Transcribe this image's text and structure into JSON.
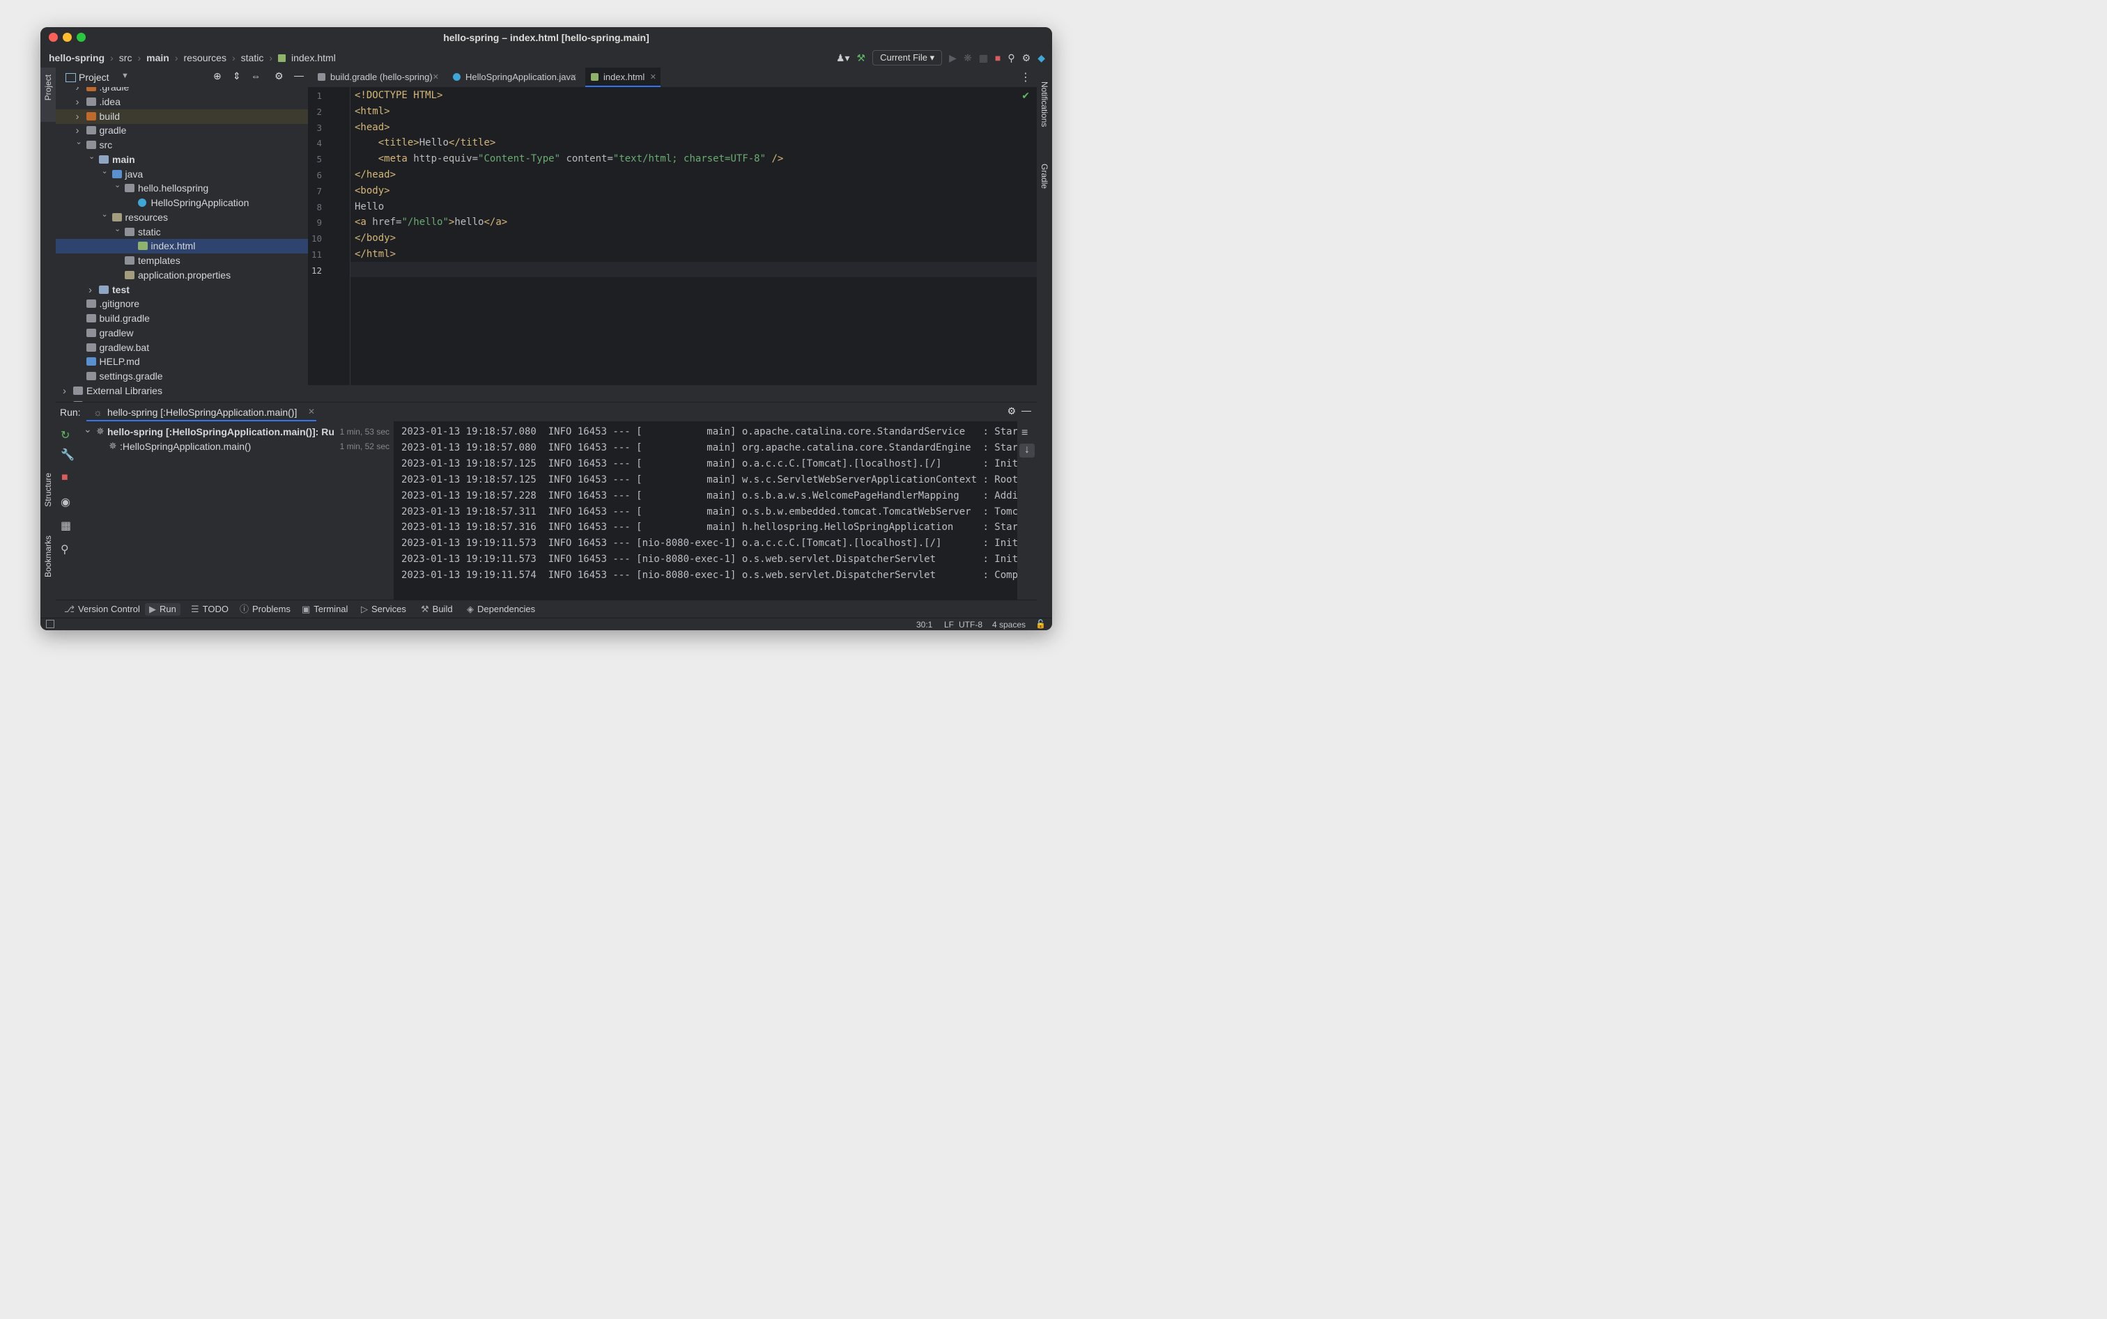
{
  "window": {
    "title": "hello-spring – index.html [hello-spring.main]"
  },
  "breadcrumb": [
    "hello-spring",
    "src",
    "main",
    "resources",
    "static",
    "index.html"
  ],
  "toolbar": {
    "run_config": "Current File"
  },
  "project_panel": {
    "title": "Project"
  },
  "tree": [
    {
      "label": ".gradle",
      "depth": 1,
      "arrow": ">",
      "kind": "folder-orange"
    },
    {
      "label": ".idea",
      "depth": 1,
      "arrow": ">",
      "kind": "folder"
    },
    {
      "label": "build",
      "depth": 1,
      "arrow": ">",
      "kind": "folder-orange"
    },
    {
      "label": "gradle",
      "depth": 1,
      "arrow": ">",
      "kind": "folder"
    },
    {
      "label": "src",
      "depth": 1,
      "arrow": "v",
      "kind": "folder"
    },
    {
      "label": "main",
      "depth": 2,
      "arrow": "v",
      "kind": "folder-module",
      "bold": true
    },
    {
      "label": "java",
      "depth": 3,
      "arrow": "v",
      "kind": "folder-blue"
    },
    {
      "label": "hello.hellospring",
      "depth": 4,
      "arrow": "v",
      "kind": "package"
    },
    {
      "label": "HelloSpringApplication",
      "depth": 5,
      "arrow": "",
      "kind": "class"
    },
    {
      "label": "resources",
      "depth": 3,
      "arrow": "v",
      "kind": "folder-res"
    },
    {
      "label": "static",
      "depth": 4,
      "arrow": "v",
      "kind": "folder"
    },
    {
      "label": "index.html",
      "depth": 5,
      "arrow": "",
      "kind": "html",
      "selected": true
    },
    {
      "label": "templates",
      "depth": 4,
      "arrow": "",
      "kind": "folder"
    },
    {
      "label": "application.properties",
      "depth": 4,
      "arrow": "",
      "kind": "props"
    },
    {
      "label": "test",
      "depth": 2,
      "arrow": ">",
      "kind": "folder-module",
      "bold": true
    },
    {
      "label": ".gitignore",
      "depth": 1,
      "arrow": "",
      "kind": "file"
    },
    {
      "label": "build.gradle",
      "depth": 1,
      "arrow": "",
      "kind": "gradle"
    },
    {
      "label": "gradlew",
      "depth": 1,
      "arrow": "",
      "kind": "exec"
    },
    {
      "label": "gradlew.bat",
      "depth": 1,
      "arrow": "",
      "kind": "file"
    },
    {
      "label": "HELP.md",
      "depth": 1,
      "arrow": "",
      "kind": "md"
    },
    {
      "label": "settings.gradle",
      "depth": 1,
      "arrow": "",
      "kind": "gradle"
    },
    {
      "label": "External Libraries",
      "depth": 0,
      "arrow": ">",
      "kind": "libs"
    },
    {
      "label": "Scratches and Consoles",
      "depth": 0,
      "arrow": ">",
      "kind": "scratch"
    }
  ],
  "editor_tabs": [
    {
      "label": "build.gradle (hello-spring)",
      "active": false
    },
    {
      "label": "HelloSpringApplication.java",
      "active": false
    },
    {
      "label": "index.html",
      "active": true
    }
  ],
  "code_lines": [
    [
      {
        "t": "<!DOCTYPE HTML>",
        "c": "tag"
      }
    ],
    [
      {
        "t": "<html>",
        "c": "tag"
      }
    ],
    [
      {
        "t": "<head>",
        "c": "tag"
      }
    ],
    [
      {
        "t": "    ",
        "c": "txt"
      },
      {
        "t": "<title>",
        "c": "tag"
      },
      {
        "t": "Hello",
        "c": "txt"
      },
      {
        "t": "</title>",
        "c": "tag"
      }
    ],
    [
      {
        "t": "    ",
        "c": "txt"
      },
      {
        "t": "<meta ",
        "c": "tag"
      },
      {
        "t": "http-equiv=",
        "c": "attr"
      },
      {
        "t": "\"Content-Type\"",
        "c": "val"
      },
      {
        "t": " content=",
        "c": "attr"
      },
      {
        "t": "\"text/html; charset=UTF-8\"",
        "c": "val"
      },
      {
        "t": " />",
        "c": "tag"
      }
    ],
    [
      {
        "t": "</head>",
        "c": "tag"
      }
    ],
    [
      {
        "t": "<body>",
        "c": "tag"
      }
    ],
    [
      {
        "t": "Hello",
        "c": "txt"
      }
    ],
    [
      {
        "t": "<a ",
        "c": "tag"
      },
      {
        "t": "href=",
        "c": "attr"
      },
      {
        "t": "\"/hello\"",
        "c": "val"
      },
      {
        "t": ">",
        "c": "tag"
      },
      {
        "t": "hello",
        "c": "txt"
      },
      {
        "t": "</a>",
        "c": "tag"
      }
    ],
    [
      {
        "t": "</body>",
        "c": "tag"
      }
    ],
    [
      {
        "t": "</html>",
        "c": "tag"
      }
    ],
    []
  ],
  "run_panel": {
    "label": "Run:",
    "tab": "hello-spring [:HelloSpringApplication.main()]",
    "items": [
      {
        "label": "hello-spring [:HelloSpringApplication.main()]: Ru",
        "time": "1 min, 53 sec"
      },
      {
        "label": ":HelloSpringApplication.main()",
        "time": "1 min, 52 sec"
      }
    ]
  },
  "console_lines": [
    "2023-01-13 19:18:57.080  INFO 16453 --- [           main] o.apache.catalina.core.StandardService   : Start",
    "2023-01-13 19:18:57.080  INFO 16453 --- [           main] org.apache.catalina.core.StandardEngine  : Start",
    "2023-01-13 19:18:57.125  INFO 16453 --- [           main] o.a.c.c.C.[Tomcat].[localhost].[/]       : Initi",
    "2023-01-13 19:18:57.125  INFO 16453 --- [           main] w.s.c.ServletWebServerApplicationContext : Root W",
    "2023-01-13 19:18:57.228  INFO 16453 --- [           main] o.s.b.a.w.s.WelcomePageHandlerMapping    : Adding",
    "2023-01-13 19:18:57.311  INFO 16453 --- [           main] o.s.b.w.embedded.tomcat.TomcatWebServer  : Tomcat",
    "2023-01-13 19:18:57.316  INFO 16453 --- [           main] h.hellospring.HelloSpringApplication     : Starte",
    "2023-01-13 19:19:11.573  INFO 16453 --- [nio-8080-exec-1] o.a.c.c.C.[Tomcat].[localhost].[/]       : Initia",
    "2023-01-13 19:19:11.573  INFO 16453 --- [nio-8080-exec-1] o.s.web.servlet.DispatcherServlet        : Initia",
    "2023-01-13 19:19:11.574  INFO 16453 --- [nio-8080-exec-1] o.s.web.servlet.DispatcherServlet        : Comple"
  ],
  "bottom_tabs": [
    "Version Control",
    "Run",
    "TODO",
    "Problems",
    "Terminal",
    "Services",
    "Build",
    "Dependencies"
  ],
  "status": {
    "position": "30:1",
    "line_sep": "LF",
    "encoding": "UTF-8",
    "indent": "4 spaces"
  },
  "side_labels": {
    "project": "Project",
    "structure": "Structure",
    "bookmarks": "Bookmarks",
    "notifications": "Notifications",
    "gradle": "Gradle"
  },
  "colors": {
    "bg": "#2b2d30",
    "editor_bg": "#1e1f22",
    "selected_row": "#2e436e",
    "orange_folder": "#c0692c",
    "tag": "#d5b778",
    "string": "#6aab73"
  }
}
